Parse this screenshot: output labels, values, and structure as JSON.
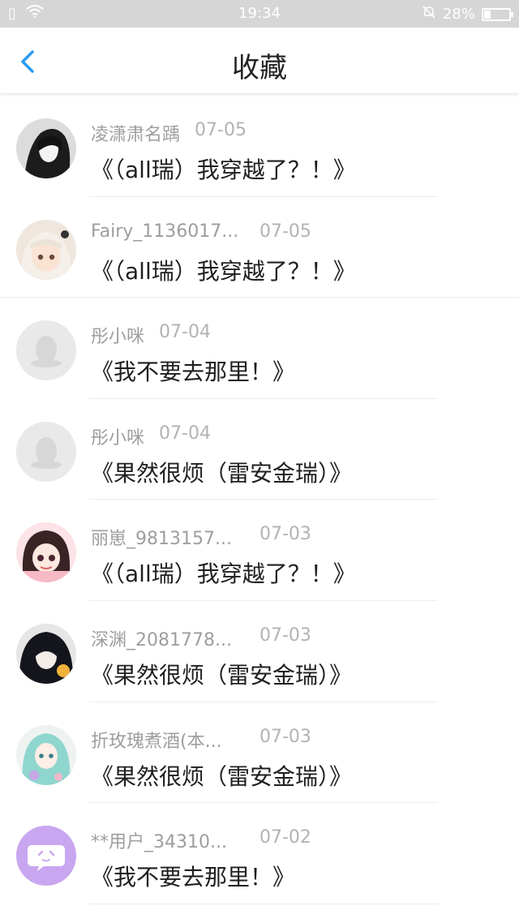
{
  "status": {
    "time": "19:34",
    "battery": "28%",
    "battery_level": 0.28
  },
  "nav": {
    "title": "收藏"
  },
  "items": [
    {
      "name": "凌潇肃名踽",
      "date": "07-05",
      "title": "《（all瑞）我穿越了？！》",
      "avatar": "dark-photo"
    },
    {
      "name": "Fairy_1136017...",
      "date": "07-05",
      "title": "《（all瑞）我穿越了？！》",
      "avatar": "anime-white-hair"
    },
    {
      "name": "彤小咪",
      "date": "07-04",
      "title": "《我不要去那里！》",
      "avatar": "default-penguin"
    },
    {
      "name": "彤小咪",
      "date": "07-04",
      "title": "《果然很烦（雷安金瑞）》",
      "avatar": "default-penguin"
    },
    {
      "name": "丽崽_9813157...",
      "date": "07-03",
      "title": "《（all瑞）我穿越了？！》",
      "avatar": "anime-pink"
    },
    {
      "name": "深渊_2081778...",
      "date": "07-03",
      "title": "《果然很烦（雷安金瑞）》",
      "avatar": "anime-dark"
    },
    {
      "name": "折玫瑰煮酒(本...",
      "date": "07-03",
      "title": "《果然很烦（雷安金瑞）》",
      "avatar": "anime-teal"
    },
    {
      "name": "**用户_34310...",
      "date": "07-02",
      "title": "《我不要去那里！》",
      "avatar": "purple-chat"
    }
  ]
}
